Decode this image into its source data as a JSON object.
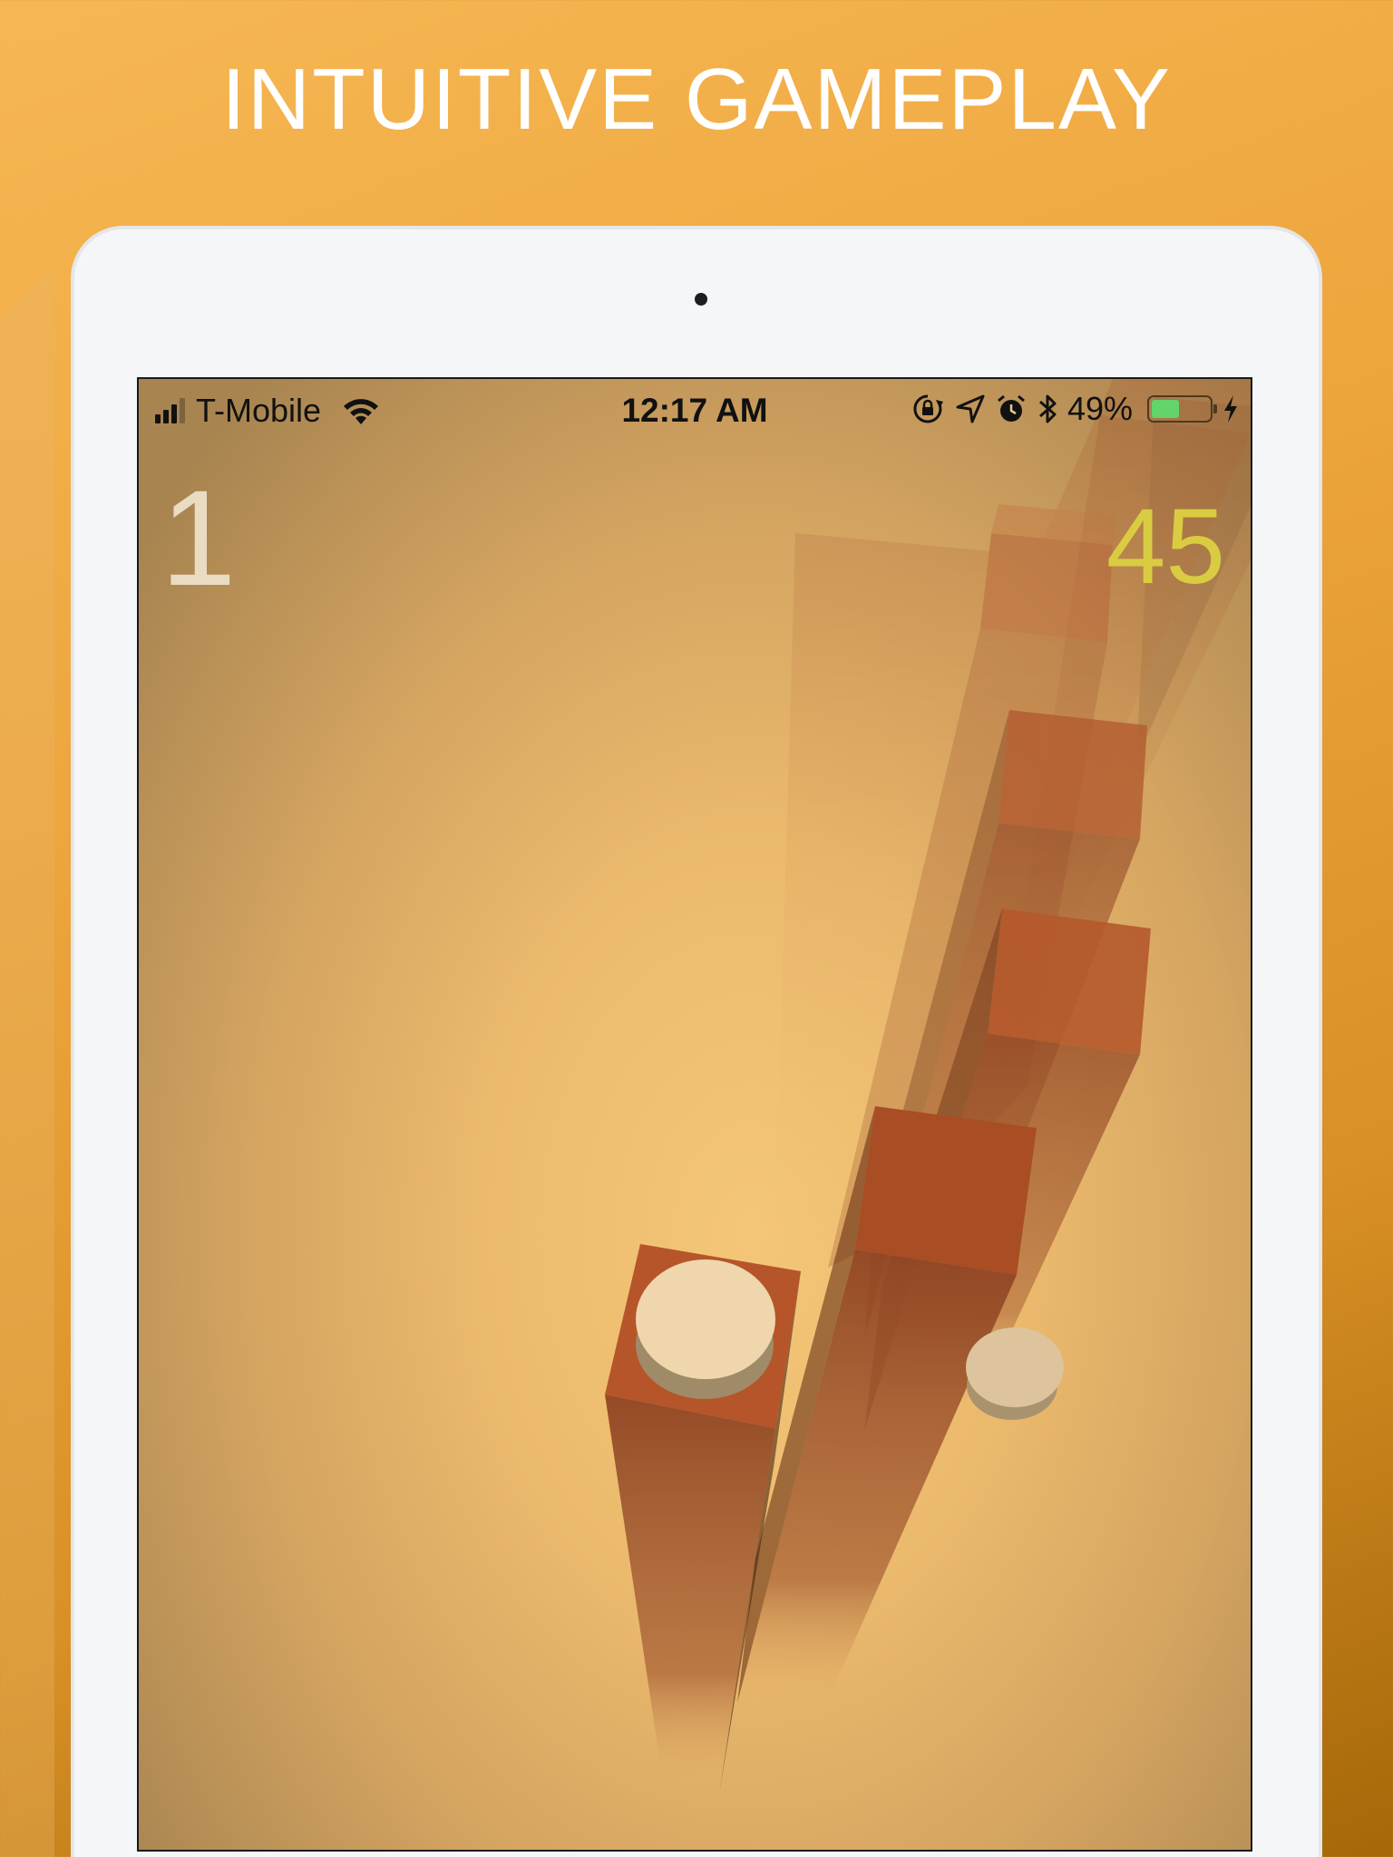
{
  "headline": "INTUITIVE GAMEPLAY",
  "status_bar": {
    "carrier": "T-Mobile",
    "time": "12:17 AM",
    "battery_percent": "49%",
    "battery_level": 0.49,
    "icons": [
      "cellular-signal-icon",
      "wifi-icon",
      "orientation-lock-icon",
      "location-arrow-icon",
      "alarm-icon",
      "bluetooth-icon",
      "battery-icon",
      "charging-bolt-icon"
    ]
  },
  "game": {
    "level": "1",
    "score": "45"
  },
  "colors": {
    "background_top": "#f6b753",
    "background_bottom": "#a56809",
    "score": "#d9cc42",
    "level": "#e9dcc3",
    "pillar": "#b5592c",
    "ball": "#efd6ad",
    "battery_fill": "#63d46a"
  }
}
